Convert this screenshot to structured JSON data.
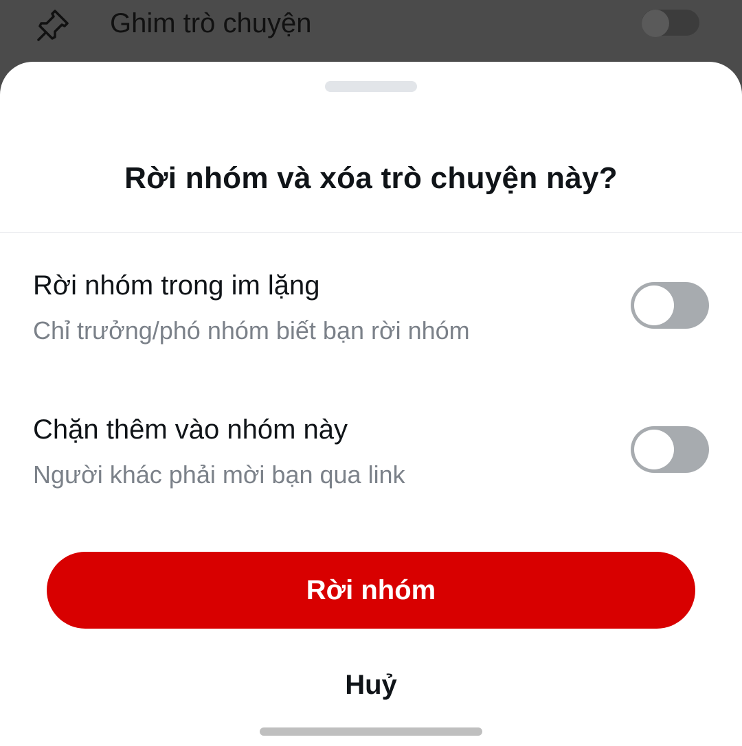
{
  "background": {
    "pin_row": {
      "icon": "pin-icon",
      "label": "Ghim trò chuyện",
      "toggle_state": "off"
    }
  },
  "sheet": {
    "title": "Rời nhóm và xóa trò chuyện này?",
    "options": [
      {
        "title": "Rời nhóm trong im lặng",
        "subtitle": "Chỉ trưởng/phó nhóm biết bạn rời nhóm",
        "toggle_state": "off"
      },
      {
        "title": "Chặn thêm vào nhóm này",
        "subtitle": "Người khác phải mời bạn qua link",
        "toggle_state": "off"
      }
    ],
    "primary_button": "Rời nhóm",
    "cancel_button": "Huỷ"
  },
  "colors": {
    "primary": "#d80000",
    "toggle_off": "#a7abaf",
    "overlay": "#4b4b4b",
    "subtitle_text": "#7b8189"
  }
}
